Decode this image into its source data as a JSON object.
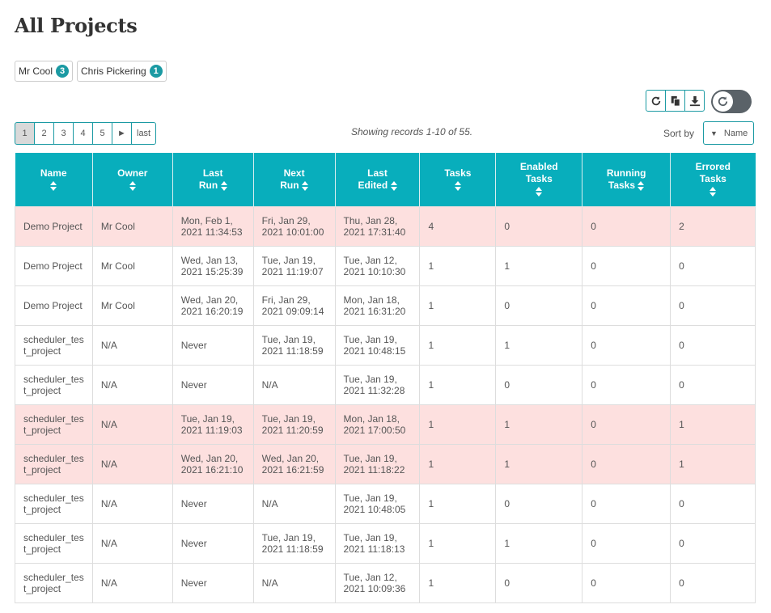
{
  "page": {
    "title": "All Projects"
  },
  "owner_filters": [
    {
      "label": "Mr Cool",
      "count": "3"
    },
    {
      "label": "Chris Pickering",
      "count": "1"
    }
  ],
  "actions": {
    "icons": [
      "refresh-icon",
      "copy-icon",
      "download-icon"
    ],
    "toggle_icon": "refresh-icon"
  },
  "pagination": {
    "pages": [
      "1",
      "2",
      "3",
      "4",
      "5"
    ],
    "next": "►",
    "last": "last",
    "active_page": "1"
  },
  "records_info": "Showing records 1-10 of 55.",
  "sort": {
    "label": "Sort by",
    "value": "Name",
    "indicator": "▼"
  },
  "table": {
    "columns": [
      {
        "line1": "Name",
        "line2": ""
      },
      {
        "line1": "Owner",
        "line2": ""
      },
      {
        "line1": "Last",
        "line2": "Run"
      },
      {
        "line1": "Next",
        "line2": "Run"
      },
      {
        "line1": "Last",
        "line2": "Edited"
      },
      {
        "line1": "Tasks",
        "line2": ""
      },
      {
        "line1": "Enabled",
        "line2": "Tasks"
      },
      {
        "line1": "Running",
        "line2": "Tasks"
      },
      {
        "line1": "Errored",
        "line2": "Tasks"
      }
    ],
    "rows": [
      {
        "errored": true,
        "cells": [
          "Demo Project",
          "Mr Cool",
          "Mon, Feb 1, 2021 11:34:53",
          "Fri, Jan 29, 2021 10:01:00",
          "Thu, Jan 28, 2021 17:31:40",
          "4",
          "0",
          "0",
          "2"
        ]
      },
      {
        "errored": false,
        "cells": [
          "Demo Project",
          "Mr Cool",
          "Wed, Jan 13, 2021 15:25:39",
          "Tue, Jan 19, 2021 11:19:07",
          "Tue, Jan 12, 2021 10:10:30",
          "1",
          "1",
          "0",
          "0"
        ]
      },
      {
        "errored": false,
        "cells": [
          "Demo Project",
          "Mr Cool",
          "Wed, Jan 20, 2021 16:20:19",
          "Fri, Jan 29, 2021 09:09:14",
          "Mon, Jan 18, 2021 16:31:20",
          "1",
          "0",
          "0",
          "0"
        ]
      },
      {
        "errored": false,
        "cells": [
          "scheduler_test_project",
          "N/A",
          "Never",
          "Tue, Jan 19, 2021 11:18:59",
          "Tue, Jan 19, 2021 10:48:15",
          "1",
          "1",
          "0",
          "0"
        ]
      },
      {
        "errored": false,
        "cells": [
          "scheduler_test_project",
          "N/A",
          "Never",
          "N/A",
          "Tue, Jan 19, 2021 11:32:28",
          "1",
          "0",
          "0",
          "0"
        ]
      },
      {
        "errored": true,
        "cells": [
          "scheduler_test_project",
          "N/A",
          "Tue, Jan 19, 2021 11:19:03",
          "Tue, Jan 19, 2021 11:20:59",
          "Mon, Jan 18, 2021 17:00:50",
          "1",
          "1",
          "0",
          "1"
        ]
      },
      {
        "errored": true,
        "cells": [
          "scheduler_test_project",
          "N/A",
          "Wed, Jan 20, 2021 16:21:10",
          "Wed, Jan 20, 2021 16:21:59",
          "Tue, Jan 19, 2021 11:18:22",
          "1",
          "1",
          "0",
          "1"
        ]
      },
      {
        "errored": false,
        "cells": [
          "scheduler_test_project",
          "N/A",
          "Never",
          "N/A",
          "Tue, Jan 19, 2021 10:48:05",
          "1",
          "0",
          "0",
          "0"
        ]
      },
      {
        "errored": false,
        "cells": [
          "scheduler_test_project",
          "N/A",
          "Never",
          "Tue, Jan 19, 2021 11:18:59",
          "Tue, Jan 19, 2021 11:18:13",
          "1",
          "1",
          "0",
          "0"
        ]
      },
      {
        "errored": false,
        "cells": [
          "scheduler_test_project",
          "N/A",
          "Never",
          "N/A",
          "Tue, Jan 12, 2021 10:09:36",
          "1",
          "0",
          "0",
          "0"
        ]
      }
    ]
  },
  "colors": {
    "accent": "#08aebc",
    "border_accent": "#1b9aa3",
    "errored_row": "#fde0df",
    "toggle_bg": "#5a6268"
  }
}
